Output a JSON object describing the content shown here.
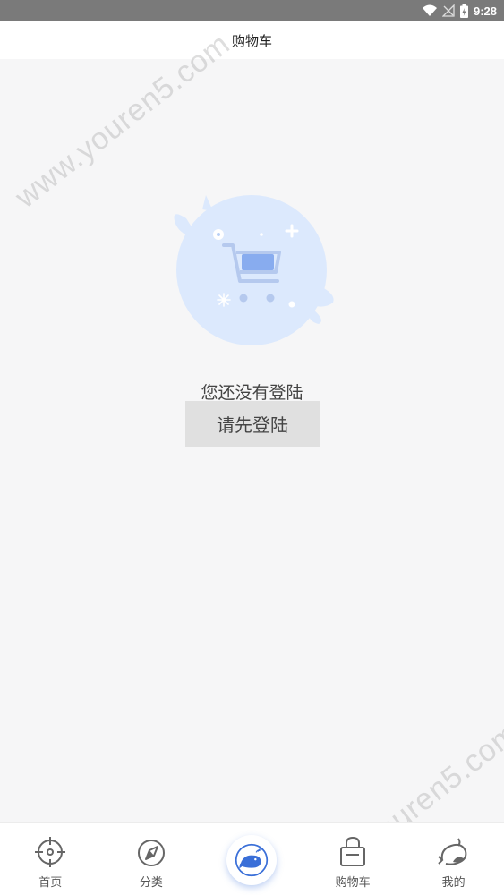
{
  "status_bar": {
    "time": "9:28"
  },
  "header": {
    "title": "购物车"
  },
  "empty_state": {
    "message": "您还没有登陆",
    "login_button": "请先登陆"
  },
  "watermark": {
    "text": "www.youren5.com"
  },
  "bottom_nav": {
    "items": [
      {
        "label": "首页",
        "icon": "home-target-icon"
      },
      {
        "label": "分类",
        "icon": "compass-icon"
      },
      {
        "label": "",
        "icon": "whale-logo-icon"
      },
      {
        "label": "购物车",
        "icon": "shopping-bag-icon"
      },
      {
        "label": "我的",
        "icon": "profile-whale-icon"
      }
    ]
  },
  "colors": {
    "accent": "#3a6fd8",
    "illustration_bg": "#dce9fd",
    "button_bg": "#e0e0e0"
  }
}
